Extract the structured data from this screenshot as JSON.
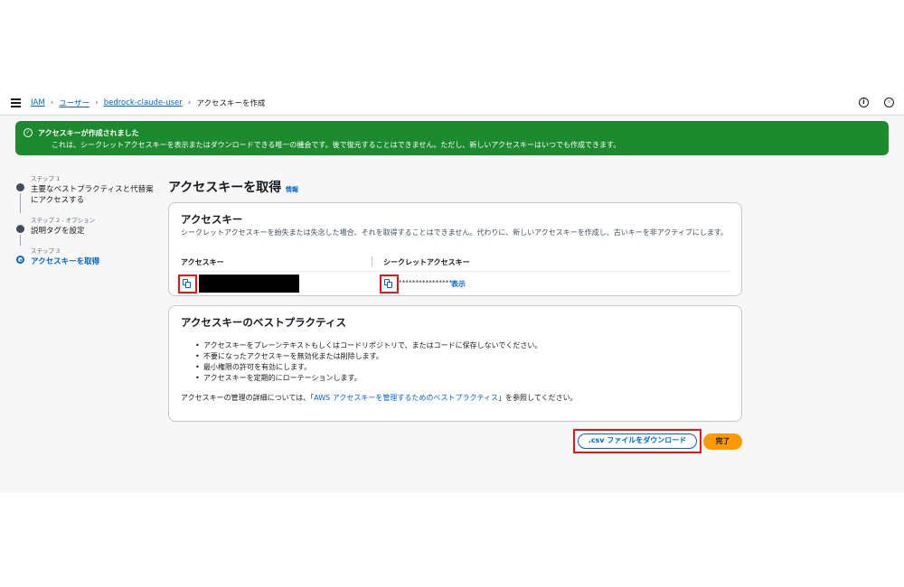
{
  "breadcrumb": {
    "items": [
      "IAM",
      "ユーザー",
      "bedrock-claude-user"
    ],
    "current": "アクセスキーを作成"
  },
  "banner": {
    "title": "アクセスキーが作成されました",
    "message": "これは、シークレットアクセスキーを表示またはダウンロードできる唯一の機会です。後で復元することはできません。ただし、新しいアクセスキーはいつでも作成できます。",
    "color": "#1d8a2f"
  },
  "steps": [
    {
      "label": "ステップ 1",
      "title": "主要なベストプラクティスと代替案にアクセスする"
    },
    {
      "label": "ステップ 2 - オプション",
      "title": "説明タグを設定"
    },
    {
      "label": "ステップ 3",
      "title": "アクセスキーを取得"
    }
  ],
  "page": {
    "title": "アクセスキーを取得",
    "info_link": "情報"
  },
  "access_key_card": {
    "heading": "アクセスキー",
    "description": "シークレットアクセスキーを紛失または失念した場合、それを取得することはできません。代わりに、新しいアクセスキーを作成し、古いキーを非アクティブにします。",
    "col_access_key": "アクセスキー",
    "col_secret_key": "シークレットアクセスキー",
    "secret_masked": "****************",
    "show_link": "表示"
  },
  "best_practices_card": {
    "heading": "アクセスキーのベストプラクティス",
    "items": [
      "アクセスキーをプレーンテキストもしくはコードリポジトリで、またはコードに保存しないでください。",
      "不要になったアクセスキーを無効化または削除します。",
      "最小権限の許可を有効にします。",
      "アクセスキーを定期的にローテーションします。"
    ],
    "footer_prefix": "アクセスキーの管理の詳細については、「",
    "footer_link": "AWS アクセスキーを管理するためのベストプラクティス",
    "footer_suffix": "」を参照してください。"
  },
  "actions": {
    "download_label": ".csv ファイルをダウンロード",
    "done_label": "完了"
  },
  "colors": {
    "link": "#0066cc",
    "primary_button": "#ff9900",
    "highlight": "#e3141b"
  }
}
